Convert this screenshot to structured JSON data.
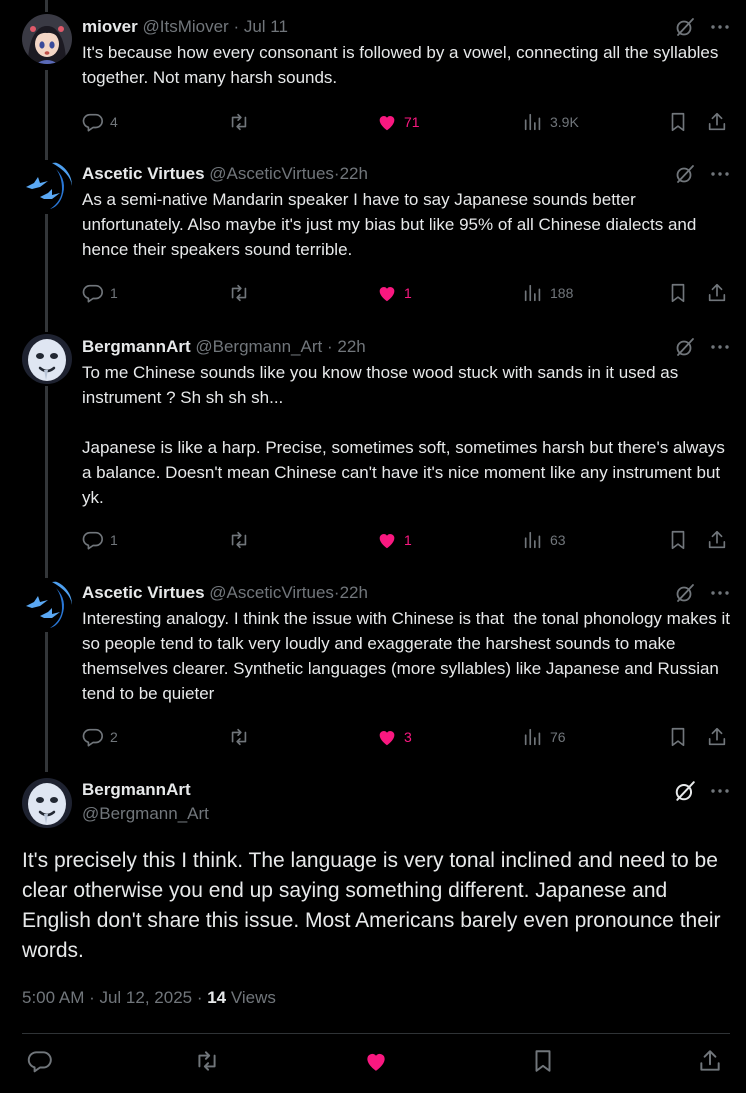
{
  "replies": [
    {
      "name": "miover",
      "handle": "@ItsMiover",
      "separator": "·",
      "time": "Jul 11",
      "text": "It's because how every consonant is followed by a vowel, connecting all the syllables together. Not many harsh sounds.",
      "stats": {
        "replies": "4",
        "likes": "71",
        "views": "3.9K"
      },
      "avatar": "anime-girl"
    },
    {
      "name": "Ascetic Virtues",
      "handle": "@AsceticVirtues",
      "separator": "·",
      "time": "22h",
      "text": "As a semi-native Mandarin speaker I have to say Japanese sounds better unfortunately. Also maybe it's just my bias but like 95% of all Chinese dialects and hence their speakers sound terrible.",
      "stats": {
        "replies": "1",
        "likes": "1",
        "views": "188"
      },
      "avatar": "blue-birds"
    },
    {
      "name": "BergmannArt",
      "handle": "@Bergmann_Art",
      "separator": "·",
      "time": "22h",
      "text": "To me Chinese sounds like you know those wood stuck with sands in it used as instrument ? Sh sh sh sh...\n\nJapanese is like a harp. Precise, sometimes soft, sometimes harsh but there's always a balance. Doesn't mean Chinese can't have it's nice moment like any instrument but yk.",
      "stats": {
        "replies": "1",
        "likes": "1",
        "views": "63"
      },
      "avatar": "pale-face"
    },
    {
      "name": "Ascetic Virtues",
      "handle": "@AsceticVirtues",
      "separator": "·",
      "time": "22h",
      "text": "Interesting analogy. I think the issue with Chinese is that  the tonal phonology makes it so people tend to talk very loudly and exaggerate the harshest sounds to make themselves clearer. Synthetic languages (more syllables) like Japanese and Russian tend to be quieter",
      "stats": {
        "replies": "2",
        "likes": "3",
        "views": "76"
      },
      "avatar": "blue-birds"
    }
  ],
  "main": {
    "name": "BergmannArt",
    "handle": "@Bergmann_Art",
    "text": "It's precisely this I think. The language is very tonal inclined and need to be clear otherwise you end up saying something different. Japanese and English don't share this issue. Most Americans barely even pronounce their words.",
    "timestamp": "5:00 AM · Jul 12, 2025 · ",
    "views_count": "14",
    "views_label": " Views"
  },
  "colors": {
    "background": "#000000",
    "text": "#e7e9ea",
    "muted": "#71767b",
    "like": "#f91880",
    "thread_line": "#333639",
    "divider": "#2f3336"
  },
  "icons": {
    "reply": "reply-icon",
    "retweet": "retweet-icon",
    "like": "heart-icon",
    "views": "views-icon",
    "bookmark": "bookmark-icon",
    "share": "share-icon",
    "grok": "grok-icon",
    "more": "more-icon"
  }
}
